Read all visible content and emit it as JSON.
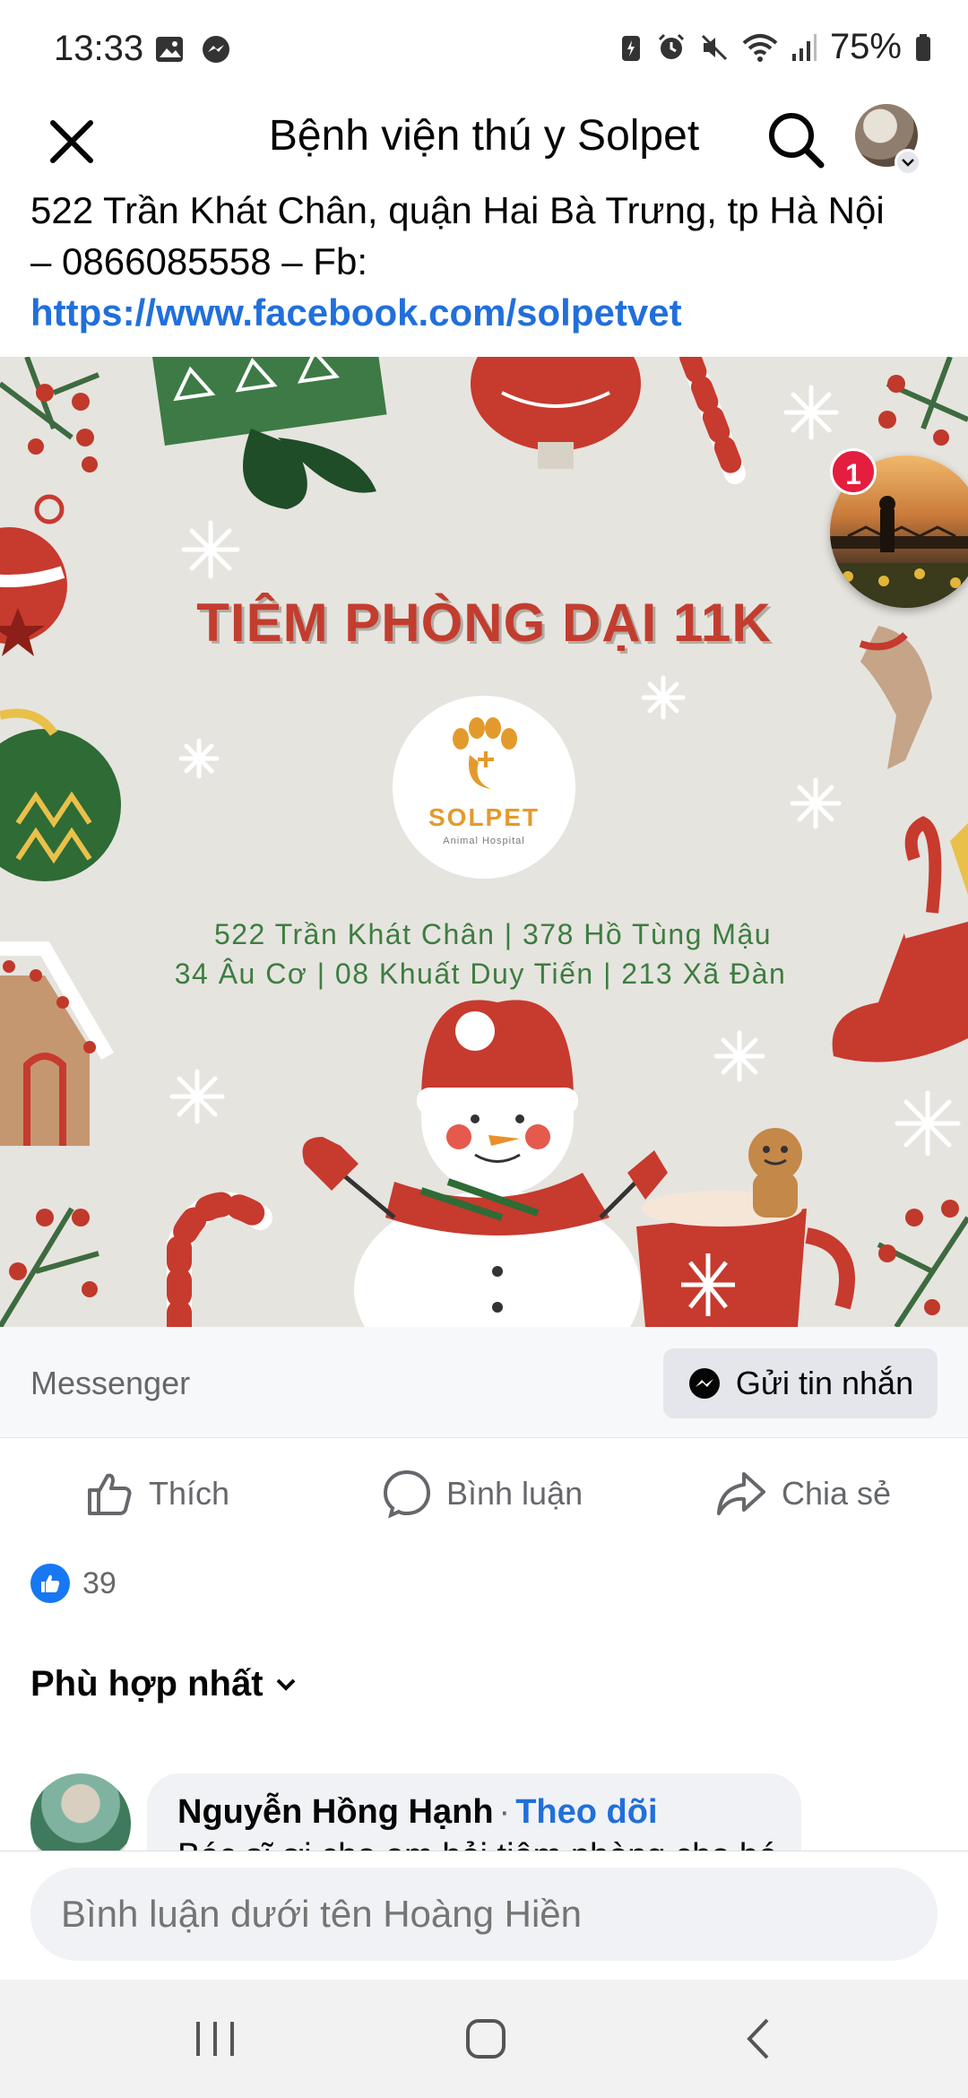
{
  "status_bar": {
    "time": "13:33",
    "battery": "75%"
  },
  "header": {
    "title": "Bệnh viện thú y Solpet"
  },
  "post": {
    "caption_line1": "522 Trần Khát Chân, quận Hai Bà Trưng, tp Hà Nội",
    "caption_line2": "– 0866085558 – Fb:",
    "caption_link": "https://www.facebook.com/solpetvet"
  },
  "poster": {
    "title": "TIÊM PHÒNG DẠI 11K",
    "logo_name": "SOLPET",
    "logo_sub": "Animal Hospital",
    "address_line1": "522 Trần Khát Chân | 378 Hồ Tùng Mậu",
    "address_line2": "34 Âu Cơ | 08 Khuất Duy Tiến | 213 Xã Đàn"
  },
  "chat_head": {
    "badge_count": "1"
  },
  "messenger": {
    "label": "Messenger",
    "send_label": "Gửi tin nhắn"
  },
  "actions": {
    "like": "Thích",
    "comment": "Bình luận",
    "share": "Chia sẻ"
  },
  "reactions": {
    "count": "39"
  },
  "sort": {
    "label": "Phù hợp nhất"
  },
  "comment": {
    "author": "Nguyễn Hồng Hạnh",
    "follow": "Theo dõi",
    "text": "Bác sĩ ơi cho em hỏi tiêm phòng cho bé"
  },
  "comment_input": {
    "placeholder": "Bình luận dưới tên Hoàng Hiền"
  },
  "colors": {
    "fb_blue": "#1877f2",
    "link_blue": "#216fdb",
    "poster_red": "#c33d2f",
    "poster_green": "#3d7d41",
    "badge_red": "#e41e3f"
  }
}
